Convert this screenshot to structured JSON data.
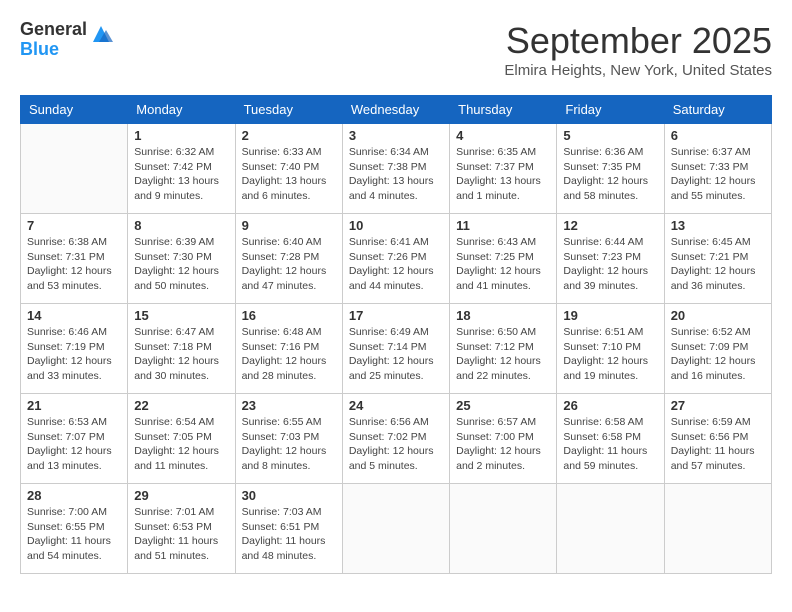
{
  "logo": {
    "general": "General",
    "blue": "Blue"
  },
  "title": {
    "month": "September 2025",
    "location": "Elmira Heights, New York, United States"
  },
  "headers": [
    "Sunday",
    "Monday",
    "Tuesday",
    "Wednesday",
    "Thursday",
    "Friday",
    "Saturday"
  ],
  "weeks": [
    [
      {
        "day": "",
        "info": ""
      },
      {
        "day": "1",
        "info": "Sunrise: 6:32 AM\nSunset: 7:42 PM\nDaylight: 13 hours\nand 9 minutes."
      },
      {
        "day": "2",
        "info": "Sunrise: 6:33 AM\nSunset: 7:40 PM\nDaylight: 13 hours\nand 6 minutes."
      },
      {
        "day": "3",
        "info": "Sunrise: 6:34 AM\nSunset: 7:38 PM\nDaylight: 13 hours\nand 4 minutes."
      },
      {
        "day": "4",
        "info": "Sunrise: 6:35 AM\nSunset: 7:37 PM\nDaylight: 13 hours\nand 1 minute."
      },
      {
        "day": "5",
        "info": "Sunrise: 6:36 AM\nSunset: 7:35 PM\nDaylight: 12 hours\nand 58 minutes."
      },
      {
        "day": "6",
        "info": "Sunrise: 6:37 AM\nSunset: 7:33 PM\nDaylight: 12 hours\nand 55 minutes."
      }
    ],
    [
      {
        "day": "7",
        "info": "Sunrise: 6:38 AM\nSunset: 7:31 PM\nDaylight: 12 hours\nand 53 minutes."
      },
      {
        "day": "8",
        "info": "Sunrise: 6:39 AM\nSunset: 7:30 PM\nDaylight: 12 hours\nand 50 minutes."
      },
      {
        "day": "9",
        "info": "Sunrise: 6:40 AM\nSunset: 7:28 PM\nDaylight: 12 hours\nand 47 minutes."
      },
      {
        "day": "10",
        "info": "Sunrise: 6:41 AM\nSunset: 7:26 PM\nDaylight: 12 hours\nand 44 minutes."
      },
      {
        "day": "11",
        "info": "Sunrise: 6:43 AM\nSunset: 7:25 PM\nDaylight: 12 hours\nand 41 minutes."
      },
      {
        "day": "12",
        "info": "Sunrise: 6:44 AM\nSunset: 7:23 PM\nDaylight: 12 hours\nand 39 minutes."
      },
      {
        "day": "13",
        "info": "Sunrise: 6:45 AM\nSunset: 7:21 PM\nDaylight: 12 hours\nand 36 minutes."
      }
    ],
    [
      {
        "day": "14",
        "info": "Sunrise: 6:46 AM\nSunset: 7:19 PM\nDaylight: 12 hours\nand 33 minutes."
      },
      {
        "day": "15",
        "info": "Sunrise: 6:47 AM\nSunset: 7:18 PM\nDaylight: 12 hours\nand 30 minutes."
      },
      {
        "day": "16",
        "info": "Sunrise: 6:48 AM\nSunset: 7:16 PM\nDaylight: 12 hours\nand 28 minutes."
      },
      {
        "day": "17",
        "info": "Sunrise: 6:49 AM\nSunset: 7:14 PM\nDaylight: 12 hours\nand 25 minutes."
      },
      {
        "day": "18",
        "info": "Sunrise: 6:50 AM\nSunset: 7:12 PM\nDaylight: 12 hours\nand 22 minutes."
      },
      {
        "day": "19",
        "info": "Sunrise: 6:51 AM\nSunset: 7:10 PM\nDaylight: 12 hours\nand 19 minutes."
      },
      {
        "day": "20",
        "info": "Sunrise: 6:52 AM\nSunset: 7:09 PM\nDaylight: 12 hours\nand 16 minutes."
      }
    ],
    [
      {
        "day": "21",
        "info": "Sunrise: 6:53 AM\nSunset: 7:07 PM\nDaylight: 12 hours\nand 13 minutes."
      },
      {
        "day": "22",
        "info": "Sunrise: 6:54 AM\nSunset: 7:05 PM\nDaylight: 12 hours\nand 11 minutes."
      },
      {
        "day": "23",
        "info": "Sunrise: 6:55 AM\nSunset: 7:03 PM\nDaylight: 12 hours\nand 8 minutes."
      },
      {
        "day": "24",
        "info": "Sunrise: 6:56 AM\nSunset: 7:02 PM\nDaylight: 12 hours\nand 5 minutes."
      },
      {
        "day": "25",
        "info": "Sunrise: 6:57 AM\nSunset: 7:00 PM\nDaylight: 12 hours\nand 2 minutes."
      },
      {
        "day": "26",
        "info": "Sunrise: 6:58 AM\nSunset: 6:58 PM\nDaylight: 11 hours\nand 59 minutes."
      },
      {
        "day": "27",
        "info": "Sunrise: 6:59 AM\nSunset: 6:56 PM\nDaylight: 11 hours\nand 57 minutes."
      }
    ],
    [
      {
        "day": "28",
        "info": "Sunrise: 7:00 AM\nSunset: 6:55 PM\nDaylight: 11 hours\nand 54 minutes."
      },
      {
        "day": "29",
        "info": "Sunrise: 7:01 AM\nSunset: 6:53 PM\nDaylight: 11 hours\nand 51 minutes."
      },
      {
        "day": "30",
        "info": "Sunrise: 7:03 AM\nSunset: 6:51 PM\nDaylight: 11 hours\nand 48 minutes."
      },
      {
        "day": "",
        "info": ""
      },
      {
        "day": "",
        "info": ""
      },
      {
        "day": "",
        "info": ""
      },
      {
        "day": "",
        "info": ""
      }
    ]
  ]
}
